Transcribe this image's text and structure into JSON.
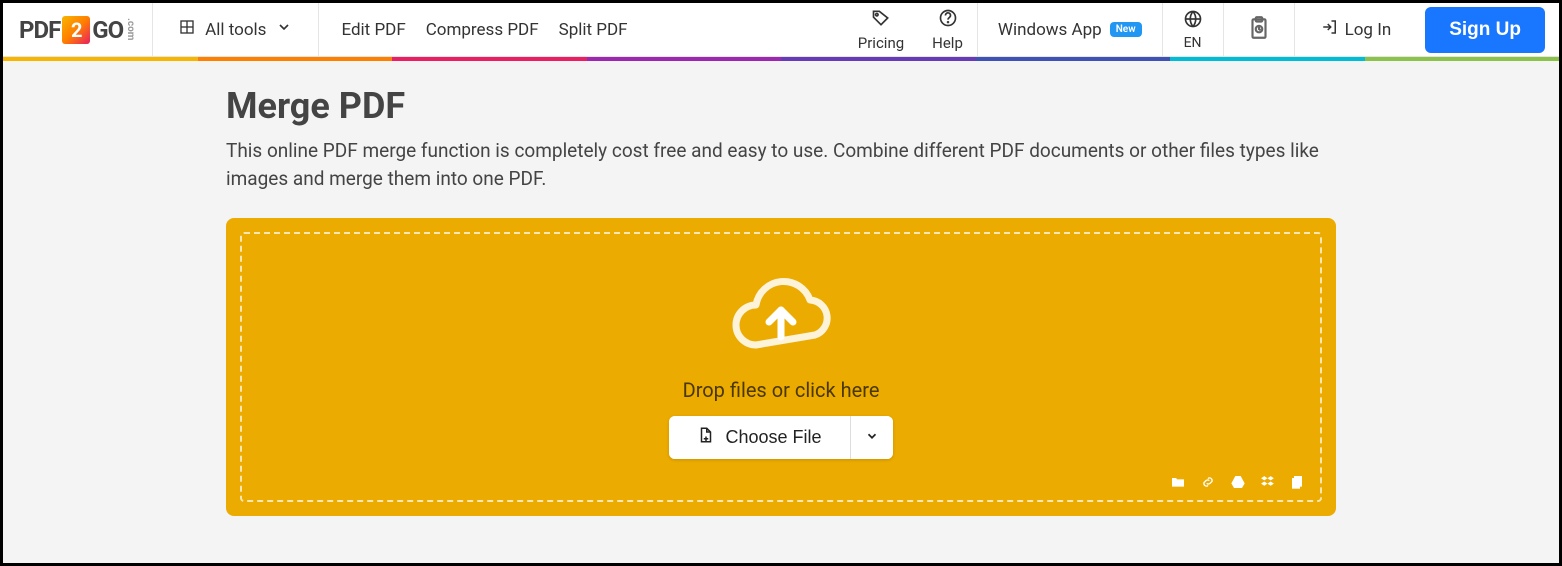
{
  "header": {
    "logo": {
      "pdf": "PDF",
      "two": "2",
      "go": "GO",
      "com": ".com"
    },
    "alltools": "All tools",
    "tools": [
      "Edit PDF",
      "Compress PDF",
      "Split PDF"
    ],
    "pricing": "Pricing",
    "help": "Help",
    "windows_app": "Windows App",
    "new_badge": "New",
    "lang": "EN",
    "login": "Log In",
    "signup": "Sign Up"
  },
  "page": {
    "title": "Merge PDF",
    "subtitle": "This online PDF merge function is completely cost free and easy to use. Combine different PDF documents or other files types like images and merge them into one PDF."
  },
  "dropzone": {
    "text": "Drop files or click here",
    "choose": "Choose File"
  }
}
